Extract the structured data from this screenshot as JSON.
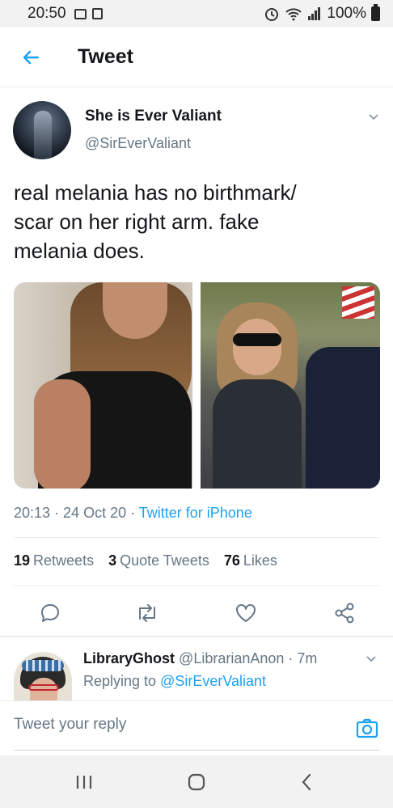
{
  "status_bar": {
    "time": "20:50",
    "battery": "100%"
  },
  "header": {
    "title": "Tweet"
  },
  "tweet": {
    "author_name": "She is Ever Valiant",
    "author_handle": "@SirEverValiant",
    "text_lines": [
      "real melania has no birthmark/",
      "scar on her right arm. fake",
      "melania does."
    ],
    "timestamp": "20:13 · 24 Oct 20 · ",
    "source": "Twitter for iPhone",
    "stats": {
      "retweets_count": "19",
      "retweets_label": "Retweets",
      "quotes_count": "3",
      "quotes_label": "Quote Tweets",
      "likes_count": "76",
      "likes_label": "Likes"
    }
  },
  "reply": {
    "name": "LibraryGhost",
    "handle_time": "@LibrarianAnon · 7m",
    "replying_to_label": "Replying to ",
    "replying_to_handle": "@SirEverValiant"
  },
  "compose": {
    "placeholder": "Tweet your reply"
  },
  "icons": [
    "back-arrow-icon",
    "chevron-down-icon",
    "reply-icon",
    "retweet-icon",
    "like-icon",
    "share-icon",
    "camera-icon",
    "recent-apps-icon",
    "home-icon",
    "back-icon"
  ],
  "colors": {
    "accent": "#1da1f2",
    "text": "#14171a",
    "secondary": "#657786"
  }
}
